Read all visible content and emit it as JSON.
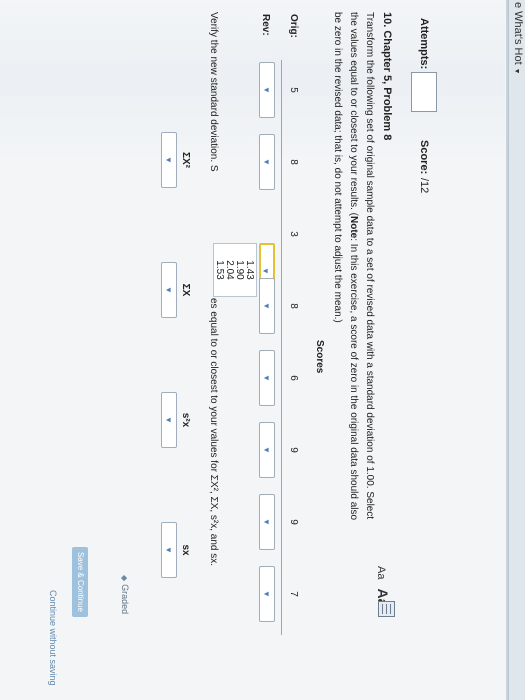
{
  "topbar": {
    "menu_label": "e What's Hot",
    "caret": "▼"
  },
  "assignment": {
    "attempts_label": "Attempts:",
    "score_label": "Score:",
    "score_value": "/12"
  },
  "problem": {
    "title": "10. Chapter 5, Problem 8",
    "font_small": "Aa",
    "font_large": "Aa",
    "instructions_line1": "Transform the following set of original sample data to a set of revised data with a standard deviation of 1.00. Select",
    "instructions_line2_pre": "the values equal to or closest to your results. (",
    "instructions_note": "Note",
    "instructions_line2_post": ": In this exercise, a score of zero in the original data should also",
    "instructions_line3": "be zero in the revised data; that is, do not attempt to adjust the mean.)"
  },
  "table": {
    "scores_header": "Scores",
    "orig_label": "Orig:",
    "rev_label": "Rev:",
    "orig_values": [
      "5",
      "8",
      "3",
      "8",
      "6",
      "9",
      "9",
      "7"
    ],
    "dropdown_arrow": "▼",
    "open_menu_options": [
      "1.43",
      "1.90",
      "2.04",
      "1.53"
    ]
  },
  "verify": {
    "text_pre": "Verify the new standard deviation. S",
    "text_post": "es equal to or closest to your values for ΣX², ΣX, s²x, and sx."
  },
  "stats": {
    "labels": [
      "ΣX²",
      "ΣX",
      "s²x",
      "sx"
    ]
  },
  "footer": {
    "graded_label": "Graded",
    "graded_icon": "◆",
    "save_button": "Save & Continue",
    "continue_link": "Continue without saving"
  }
}
